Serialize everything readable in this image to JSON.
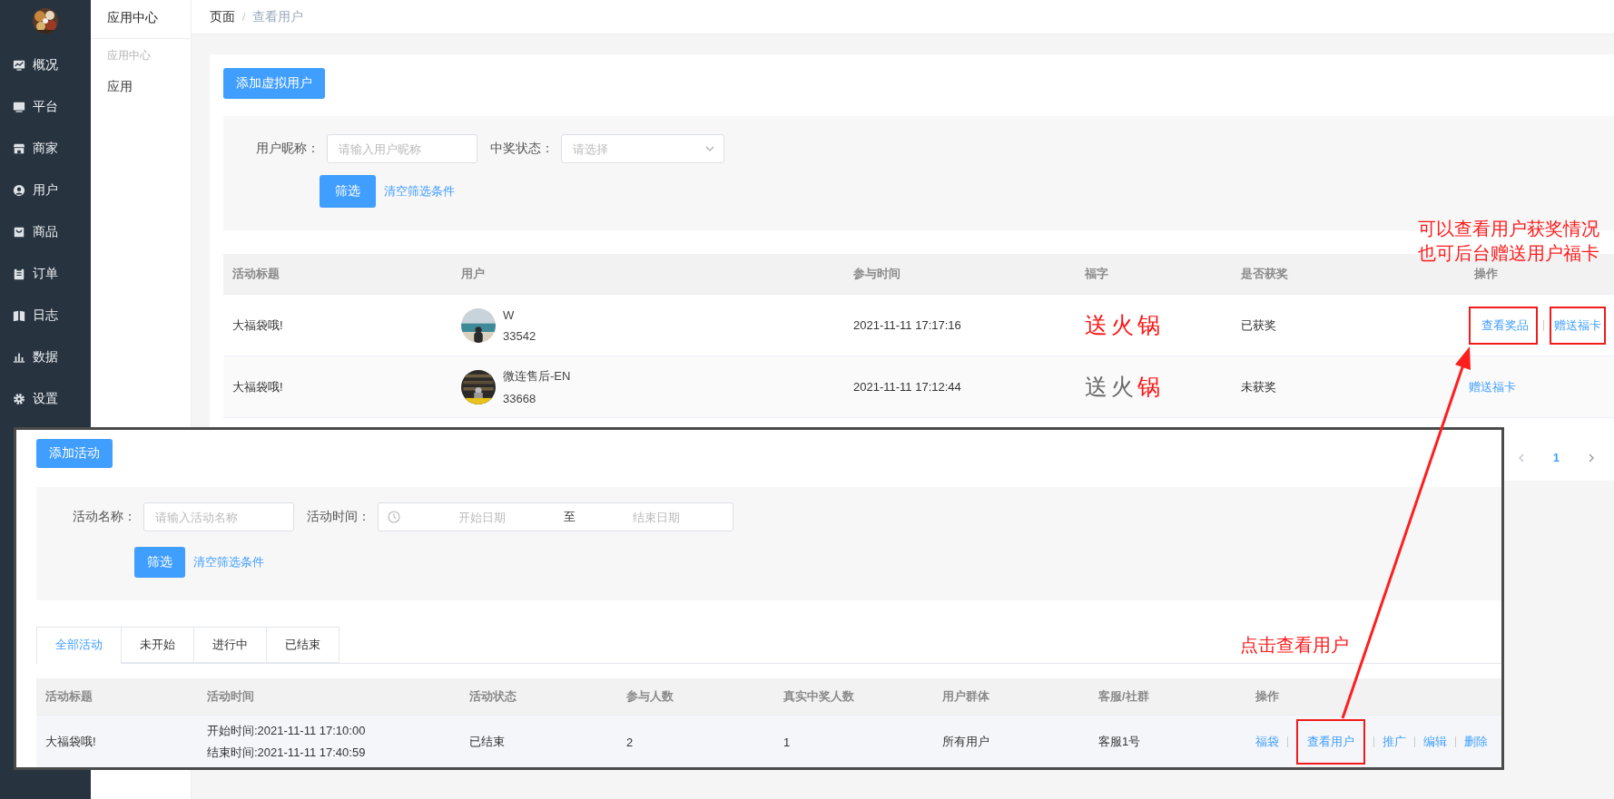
{
  "sidebar": {
    "items": [
      {
        "label": "概况"
      },
      {
        "label": "平台"
      },
      {
        "label": "商家"
      },
      {
        "label": "用户"
      },
      {
        "label": "商品"
      },
      {
        "label": "订单"
      },
      {
        "label": "日志"
      },
      {
        "label": "数据"
      },
      {
        "label": "设置"
      }
    ]
  },
  "subnav": {
    "title": "应用中心",
    "group": "应用中心",
    "items": [
      {
        "label": "应用"
      }
    ]
  },
  "breadcrumb": {
    "separator": "/",
    "items": [
      {
        "label": "页面",
        "current": false
      },
      {
        "label": "查看用户",
        "current": true
      }
    ]
  },
  "page": {
    "add_button": "添加虚拟用户",
    "filters": [
      {
        "kind": "text",
        "label": "用户昵称：",
        "placeholder": "请输入用户昵称"
      },
      {
        "kind": "select",
        "label": "中奖状态：",
        "placeholder": "请选择"
      }
    ],
    "filter_button": "筛选",
    "clear_link": "清空筛选条件",
    "table": {
      "columns": [
        "活动标题",
        "用户",
        "参与时间",
        "福字",
        "是否获奖",
        "操作"
      ],
      "rows": [
        {
          "title": "大福袋哦!",
          "user": {
            "name": "W",
            "id": "33542"
          },
          "time": "2021-11-11 17:17:16",
          "fu": [
            {
              "char": "送",
              "lit": true
            },
            {
              "char": "火",
              "lit": true
            },
            {
              "char": "锅",
              "lit": true
            }
          ],
          "status": "已获奖",
          "actions": [
            {
              "label": "查看奖品",
              "highlighted": true
            },
            {
              "label": "赠送福卡",
              "highlighted": true
            }
          ]
        },
        {
          "title": "大福袋哦!",
          "user": {
            "name": "微连售后-EN",
            "id": "33668"
          },
          "time": "2021-11-11 17:12:44",
          "fu": [
            {
              "char": "送",
              "lit": false
            },
            {
              "char": "火",
              "lit": false
            },
            {
              "char": "锅",
              "lit": true
            }
          ],
          "status": "未获奖",
          "actions": [
            {
              "label": "赠送福卡",
              "highlighted": false
            }
          ]
        }
      ]
    },
    "pagination": {
      "pages": [
        {
          "label": "1",
          "selected": true
        }
      ]
    }
  },
  "overlay": {
    "add_button": "添加活动",
    "filters": [
      {
        "kind": "text",
        "label": "活动名称：",
        "placeholder": "请输入活动名称"
      },
      {
        "kind": "daterange",
        "label": "活动时间：",
        "start_placeholder": "开始日期",
        "separator": "至",
        "end_placeholder": "结束日期"
      }
    ],
    "filter_button": "筛选",
    "clear_link": "清空筛选条件",
    "tabs": [
      {
        "label": "全部活动",
        "selected": true
      },
      {
        "label": "未开始",
        "selected": false
      },
      {
        "label": "进行中",
        "selected": false
      },
      {
        "label": "已结束",
        "selected": false
      }
    ],
    "table": {
      "columns": [
        "活动标题",
        "活动时间",
        "活动状态",
        "参与人数",
        "真实中奖人数",
        "用户群体",
        "客服/社群",
        "操作"
      ],
      "rows": [
        {
          "title": "大福袋哦!",
          "time_lines": [
            "开始时间:2021-11-11 17:10:00",
            "结束时间:2021-11-11 17:40:59"
          ],
          "status": "已结束",
          "participants": "2",
          "winners": "1",
          "audience": "所有用户",
          "service": "客服1号",
          "actions": [
            {
              "label": "福袋",
              "highlighted": false
            },
            {
              "label": "查看用户",
              "highlighted": true
            },
            {
              "label": "推广",
              "highlighted": false
            },
            {
              "label": "编辑",
              "highlighted": false
            },
            {
              "label": "删除",
              "highlighted": false
            }
          ]
        }
      ]
    }
  },
  "annotations": [
    {
      "kind": "note",
      "lines": [
        "可以查看用户获奖情况",
        "也可后台赠送用户福卡"
      ]
    },
    {
      "kind": "callout",
      "lines": [
        "点击查看用户"
      ]
    }
  ]
}
